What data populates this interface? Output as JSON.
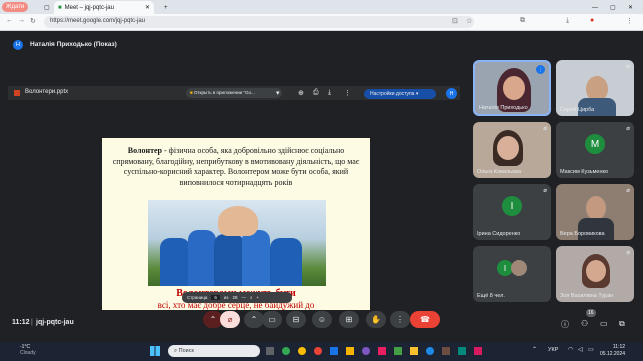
{
  "browser": {
    "profile_label": "Ждати",
    "tab_title": "Meet – jqj-pqtc-jau",
    "url": "https://meet.google.com/jqj-pqtc-jau"
  },
  "meet": {
    "presenter_label": "Наталія Приходько (Показ)",
    "presenter_initial": "Н",
    "time": "11:12",
    "meeting_code": "jqj-pqtc-jau",
    "participants_count": "16"
  },
  "presentation": {
    "file_name": "Волонтери.pptx",
    "open_in_app": "Открыть в приложении \"Go...",
    "access_settings": "Настройки доступа",
    "slide_text": "Волонтер - фізична особа, яка добровільно здійснює соціально спрямовану, благодійну, неприбуткову в вмотивовану діяльність, що має суспільно-корисний характер. Волонтером може бути особа, який виповнилося чотирнадцять років",
    "slide_bold_word": "Волонтер",
    "slide_heading": "Волонтерами можуть бути",
    "slide_subline": "всі, хто має добре серце, не байдужий до",
    "page_label": "Страница",
    "page_current": "6",
    "page_of": "из",
    "page_total": "28"
  },
  "participants": [
    {
      "name": "Наталія Приходько",
      "initial": "",
      "color": ""
    },
    {
      "name": "Сергій Цирба",
      "initial": "",
      "color": ""
    },
    {
      "name": "Ольга Ковальова",
      "initial": "",
      "color": ""
    },
    {
      "name": "Максим Кузьменко",
      "initial": "М",
      "color": "#1e8e3e"
    },
    {
      "name": "Ірина Сидоренко",
      "initial": "І",
      "color": "#1e8e3e"
    },
    {
      "name": "Вера Боровикова",
      "initial": "",
      "color": ""
    },
    {
      "name": "Ещё 8 чел.",
      "initial": "І",
      "color": "#1e8e3e"
    },
    {
      "name": "Зоя Василівна Туран",
      "initial": "",
      "color": ""
    }
  ],
  "taskbar": {
    "temperature": "-1°C",
    "weather": "Cloudy",
    "search_placeholder": "Поиск",
    "language": "УКР",
    "clock_time": "11:12",
    "clock_date": "05.12.2024"
  },
  "colors": {
    "accent": "#8ab4f8",
    "end_call": "#ea4335",
    "slide_red": "#c00000"
  }
}
